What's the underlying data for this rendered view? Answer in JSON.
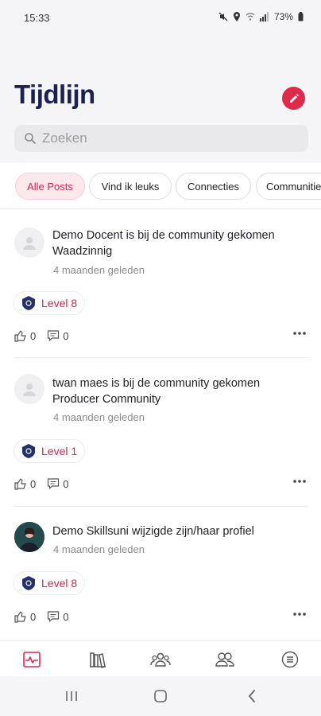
{
  "status_bar": {
    "time": "15:33",
    "battery": "73%"
  },
  "header": {
    "title": "Tijdlijn"
  },
  "search": {
    "placeholder": "Zoeken"
  },
  "filters": [
    {
      "label": "Alle Posts",
      "active": true
    },
    {
      "label": "Vind ik leuks",
      "active": false
    },
    {
      "label": "Connecties",
      "active": false
    },
    {
      "label": "Communities",
      "active": false
    }
  ],
  "posts": [
    {
      "text": "Demo Docent is bij de community gekomen Waadzinnig",
      "time": "4 maanden geleden",
      "level": "Level 8",
      "likes": "0",
      "comments": "0"
    },
    {
      "text": "twan maes is bij de community gekomen Producer Community",
      "time": "4 maanden geleden",
      "level": "Level 1",
      "likes": "0",
      "comments": "0"
    },
    {
      "text": "Demo Skillsuni wijzigde zijn/haar profiel",
      "time": "4 maanden geleden",
      "level": "Level 8",
      "likes": "0",
      "comments": "0"
    }
  ],
  "colors": {
    "brand": "#e02a4a",
    "title": "#1d2150",
    "badge_shield": "#22306b"
  },
  "tabs": [
    "activity-icon",
    "library-icon",
    "groups-icon",
    "members-icon",
    "menu-icon"
  ]
}
